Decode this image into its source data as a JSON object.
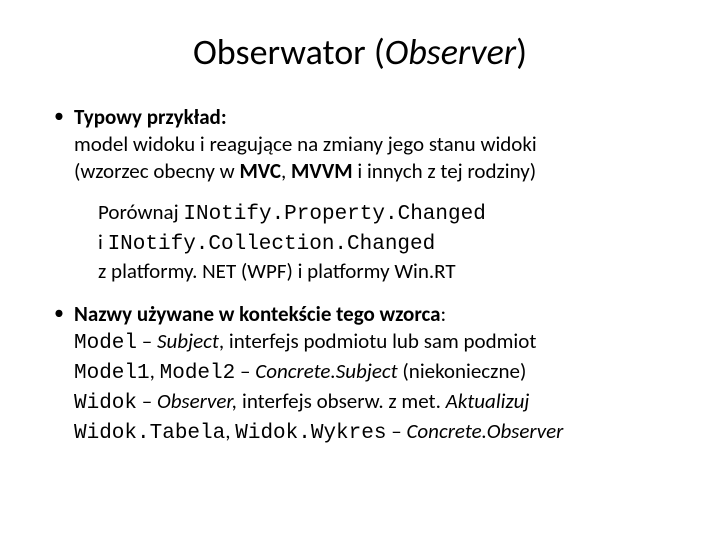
{
  "title_plain": "Obserwator (",
  "title_italic": "Observer",
  "title_close": ")",
  "b1": {
    "head": "Typowy przykład:",
    "line1a": "model widoku i reagujące na zmiany jego stanu widoki",
    "line2a": "(wzorzec obecny w ",
    "line2b": "MVC",
    "line2c": ", ",
    "line2d": "MVVM",
    "line2e": " i innych z tej rodziny)",
    "sub_l1a": "Porównaj ",
    "sub_l1b": "INotify.Property.Changed",
    "sub_l2a": "i ",
    "sub_l2b": "INotify.Collection.Changed",
    "sub_l3": "z platformy. NET (WPF) i platformy Win.RT"
  },
  "b2": {
    "head": "Nazwy używane w kontekście tego wzorca",
    "colon": ":",
    "l1a": "Model",
    "l1b": " – ",
    "l1c": "Subject",
    "l1d": ", interfejs podmiotu lub sam podmiot",
    "l2a": "Model1",
    "l2b": ", ",
    "l2c": "Model2",
    "l2d": " – ",
    "l2e": "Concrete.Subject",
    "l2f": " (niekonieczne)",
    "l3a": "Widok",
    "l3b": " – ",
    "l3c": "Observer,",
    "l3d": " interfejs obserw. z met. ",
    "l3e": "Aktualizuj",
    "l4a": "Widok.Tabela",
    "l4b": ", ",
    "l4c": "Widok.Wykres",
    "l4d": " – ",
    "l4e": "Concrete.Observer"
  }
}
